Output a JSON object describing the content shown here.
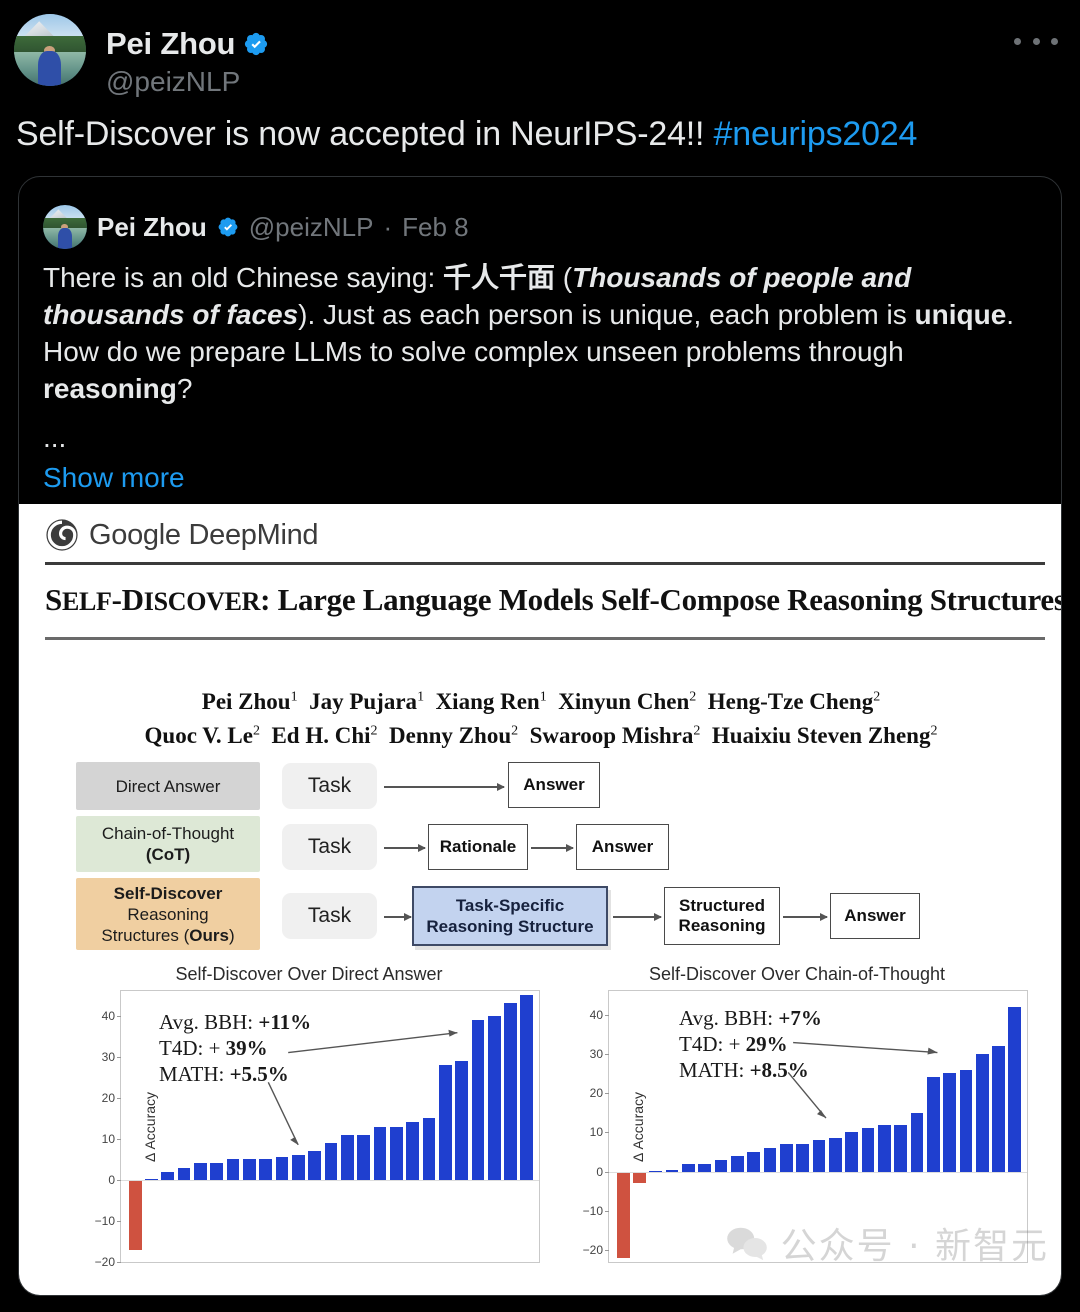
{
  "tweet": {
    "display_name": "Pei Zhou",
    "handle": "@peizNLP",
    "verified_icon": "verified-badge-icon",
    "more_icon": "more-options-icon",
    "text_before_tag": "Self-Discover is now accepted in NeurIPS-24!! ",
    "hashtag": "#neurips2024"
  },
  "quoted_tweet": {
    "display_name": "Pei Zhou",
    "handle": "@peizNLP",
    "separator": "·",
    "date": "Feb 8",
    "line1_a": "There is an old Chinese saying: ",
    "line1_cn": "千人千面",
    "line1_b": " (",
    "line1_italic": "Thousands of people and thousands of faces",
    "line1_c": "). Just as each person is unique, each problem is ",
    "line1_bold": "unique",
    "line1_d": ". How do we prepare LLMs to solve complex unseen problems through ",
    "line1_bold2": "reasoning",
    "line1_e": "?",
    "ellipsis": "...",
    "show_more": "Show more"
  },
  "paper": {
    "org_logo": "google-deepmind-logo-icon",
    "org_name": "Google DeepMind",
    "title_smallcaps_1": "S",
    "title_smallcaps_1_rest": "ELF",
    "title_dash": "-",
    "title_smallcaps_2": "D",
    "title_smallcaps_2_rest": "ISCOVER",
    "title_rest": ": Large Language Models Self-Compose Reasoning Structures",
    "authors_line1": [
      {
        "name": "Pei Zhou",
        "sup": "1"
      },
      {
        "name": "Jay Pujara",
        "sup": "1"
      },
      {
        "name": "Xiang Ren",
        "sup": "1"
      },
      {
        "name": "Xinyun Chen",
        "sup": "2"
      },
      {
        "name": "Heng-Tze Cheng",
        "sup": "2"
      }
    ],
    "authors_line2": [
      {
        "name": "Quoc V. Le",
        "sup": "2"
      },
      {
        "name": "Ed H. Chi",
        "sup": "2"
      },
      {
        "name": "Denny Zhou",
        "sup": "2"
      },
      {
        "name": "Swaroop Mishra",
        "sup": "2"
      },
      {
        "name": "Huaixiu Steven Zheng",
        "sup": "2"
      }
    ]
  },
  "diagram": {
    "labels": {
      "direct": "Direct Answer",
      "cot_line1": "Chain-of-Thought",
      "cot_line2": "(CoT)",
      "sd_line1": "Self-Discover",
      "sd_line2": "Reasoning",
      "sd_line3_a": "Structures (",
      "sd_line3_b": "Ours",
      "sd_line3_c": ")"
    },
    "task_1": "Task",
    "task_2": "Task",
    "task_3": "Task",
    "answer_1": "Answer",
    "rationale": "Rationale",
    "answer_2": "Answer",
    "task_specific_line1": "Task-Specific",
    "task_specific_line2": "Reasoning Structure",
    "structured_line1": "Structured",
    "structured_line2": "Reasoning",
    "answer_3": "Answer",
    "colors": {
      "direct_bg": "#d4d4d4",
      "cot_bg": "#dde8d6",
      "sd_bg": "#f0cfa1",
      "task_bg": "#f0f0f0",
      "highlight_bg": "#c3d3ef",
      "highlight_border": "#3e4a66"
    }
  },
  "watermark": {
    "icon": "wechat-icon",
    "text": "公众号 · 新智元"
  },
  "chart_data": [
    {
      "type": "bar",
      "title": "Self-Discover Over Direct Answer",
      "xlabel": "",
      "ylabel": "Δ Accuracy",
      "ylim": [
        -20,
        46
      ],
      "yticks": [
        -20,
        -10,
        0,
        10,
        20,
        30,
        40
      ],
      "grid": false,
      "legend": "none",
      "bar_color_positive": "#1f3fcf",
      "bar_color_negative": "#cf5240",
      "values": [
        -17,
        0.3,
        2,
        3,
        4,
        4,
        5,
        5,
        5,
        5.5,
        6,
        7,
        9,
        11,
        11,
        13,
        13,
        14,
        15,
        28,
        29,
        39,
        40,
        43,
        45
      ],
      "annotations": [
        {
          "label": "Avg. BBH: ",
          "value": "+11%"
        },
        {
          "label": "T4D: + ",
          "value": "39%"
        },
        {
          "label": "MATH: ",
          "value": "+5.5%"
        }
      ]
    },
    {
      "type": "bar",
      "title": "Self-Discover Over Chain-of-Thought",
      "xlabel": "",
      "ylabel": "Δ Accuracy",
      "ylim": [
        -23,
        46
      ],
      "yticks": [
        -20,
        -10,
        0,
        10,
        20,
        30,
        40
      ],
      "grid": false,
      "legend": "none",
      "bar_color_positive": "#1f3fcf",
      "bar_color_negative": "#cf5240",
      "values": [
        -22,
        -3,
        0.2,
        0.3,
        2,
        2,
        3,
        4,
        5,
        6,
        7,
        7,
        8,
        8.5,
        10,
        11,
        12,
        12,
        15,
        24,
        25,
        26,
        30,
        32,
        42
      ],
      "annotations": [
        {
          "label": "Avg. BBH: ",
          "value": "+7%"
        },
        {
          "label": "T4D: + ",
          "value": "29%"
        },
        {
          "label": "MATH: ",
          "value": "+8.5%"
        }
      ]
    }
  ]
}
